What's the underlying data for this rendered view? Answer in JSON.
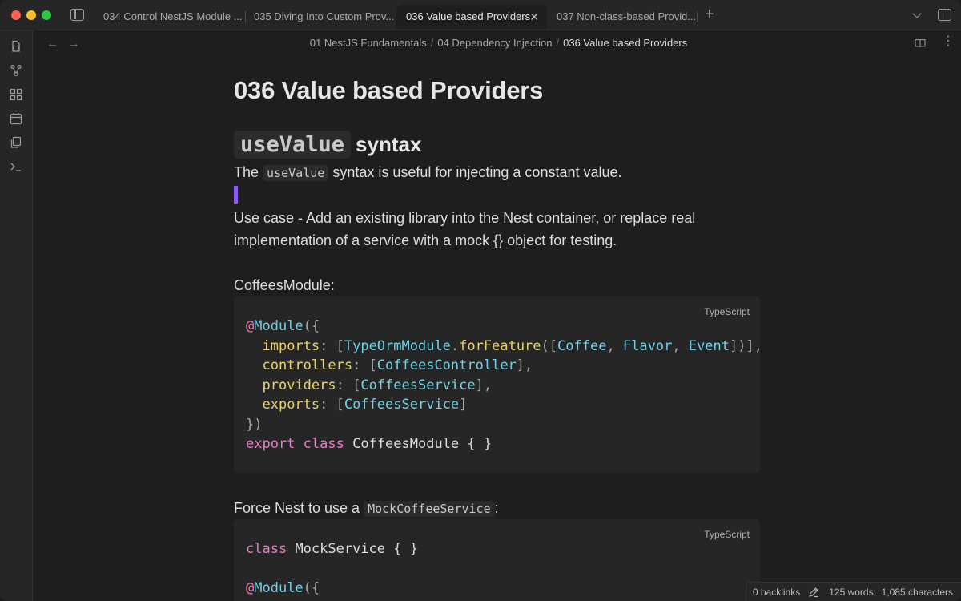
{
  "tabs": [
    {
      "label": "034 Control NestJS Module ...",
      "active": false
    },
    {
      "label": "035 Diving Into Custom Prov...",
      "active": false
    },
    {
      "label": "036 Value based Providers",
      "active": true
    },
    {
      "label": "037 Non-class-based Provid...",
      "active": false
    }
  ],
  "tab_close_glyph": "✕",
  "new_tab_glyph": "+",
  "nav": {
    "back": "←",
    "forward": "→"
  },
  "breadcrumb": {
    "part1": "01 NestJS Fundamentals",
    "part2": "04 Dependency Injection",
    "current": "036 Value based Providers",
    "separator": "/"
  },
  "more_glyph": "⋮",
  "doc": {
    "title": "036 Value based Providers",
    "h2_code": "useValue",
    "h2_rest": "syntax",
    "p1_before": "The",
    "p1_code": "useValue",
    "p1_after": "syntax is useful for injecting a constant value.",
    "p2_line1": "Use case - Add an existing library into the Nest container, or replace real",
    "p2_line2": "implementation of a service with a mock {} object for testing.",
    "label_coffees": "CoffeesModule:",
    "force_before": "Force Nest to use a",
    "force_code": "MockCoffeeService",
    "force_after": ":"
  },
  "code1": {
    "lang": "TypeScript",
    "lines": [
      "@Module({",
      "  imports: [TypeOrmModule.forFeature([Coffee, Flavor, Event])],",
      "  controllers: [CoffeesController],",
      "  providers: [CoffeesService],",
      "  exports: [CoffeesService]",
      "})",
      "export class CoffeesModule { }"
    ]
  },
  "code2": {
    "lang": "TypeScript",
    "lines": [
      "class MockService { }",
      "",
      "@Module({"
    ]
  },
  "status": {
    "backlinks": "0 backlinks",
    "words": "125 words",
    "characters": "1,085 characters"
  },
  "icons": {
    "ribbon": [
      "files-icon",
      "graph-icon",
      "grid-icon",
      "calendar-icon",
      "copy-icon",
      "terminal-icon"
    ]
  },
  "colors": {
    "accent": "#8a5cf5",
    "background": "#1e1e1e"
  }
}
